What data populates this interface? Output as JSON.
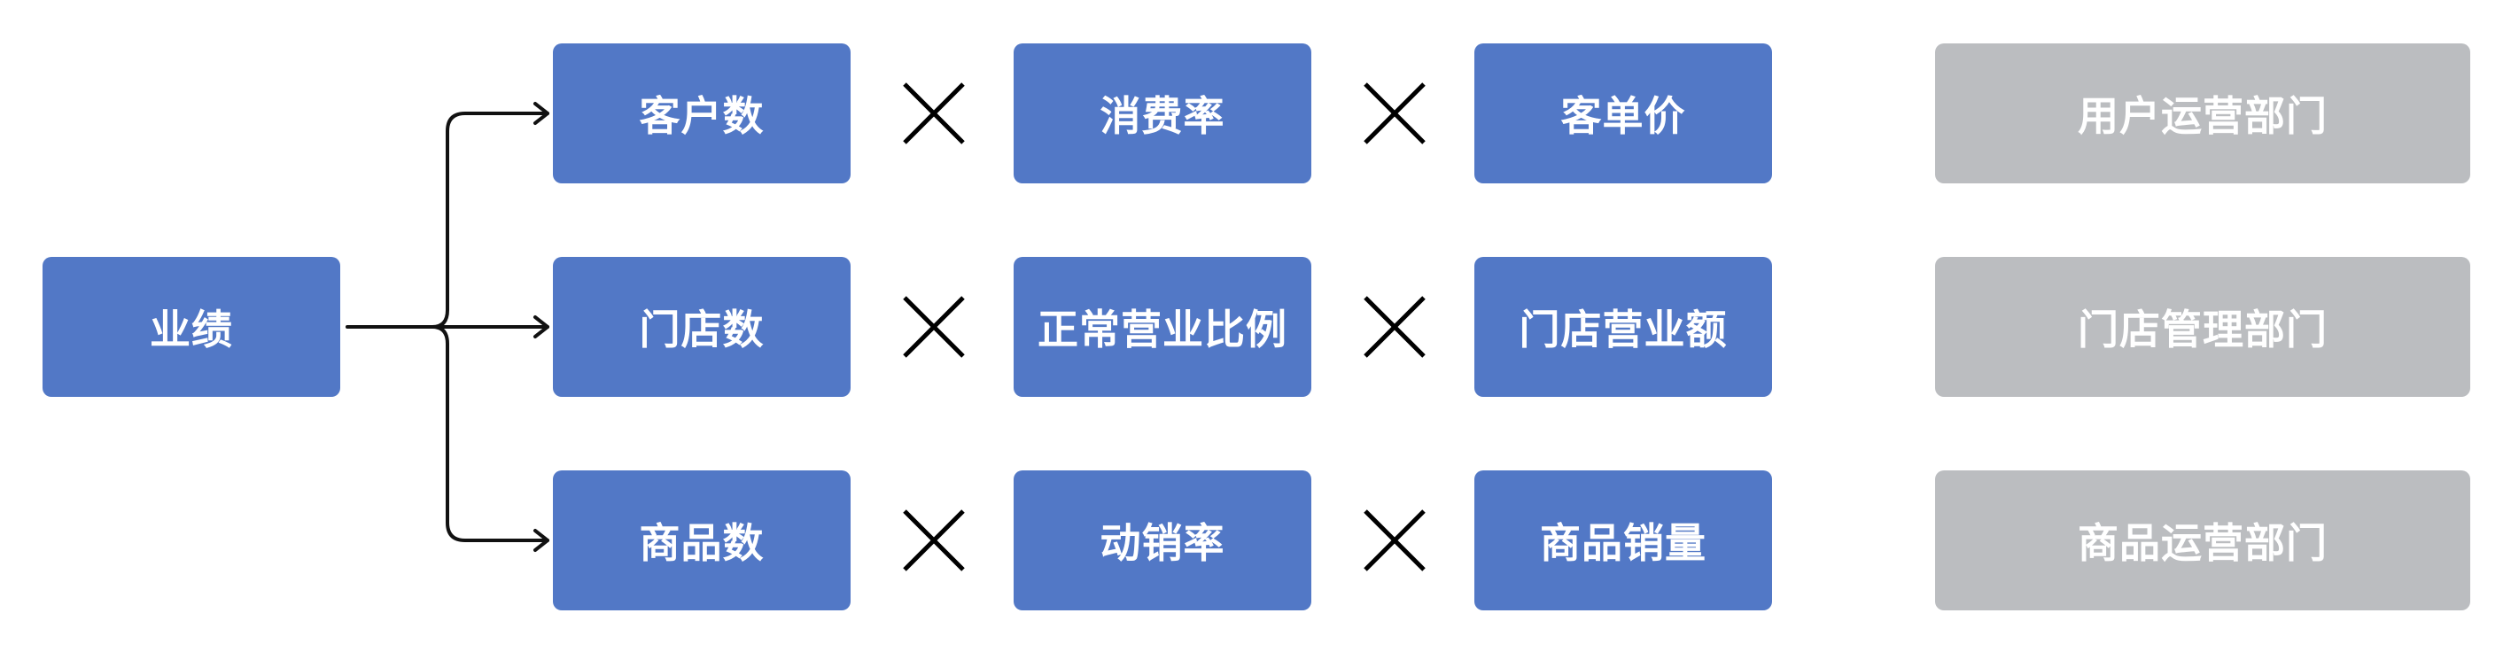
{
  "root": {
    "label": "业绩"
  },
  "rows": [
    {
      "factors": [
        "客户数",
        "消费率",
        "客单价"
      ],
      "department": "用户运营部门"
    },
    {
      "factors": [
        "门店数",
        "正常营业比例",
        "门店营业额"
      ],
      "department": "门店管理部门"
    },
    {
      "factors": [
        "商品数",
        "动销率",
        "商品销量"
      ],
      "department": "商品运营部门"
    }
  ],
  "colors": {
    "factor_box": "#5278c6",
    "department_box": "#bbbdc0",
    "text": "#ffffff",
    "line": "#111111"
  },
  "icons": {
    "multiply": "multiply-icon",
    "arrow": "arrow-right-icon"
  }
}
